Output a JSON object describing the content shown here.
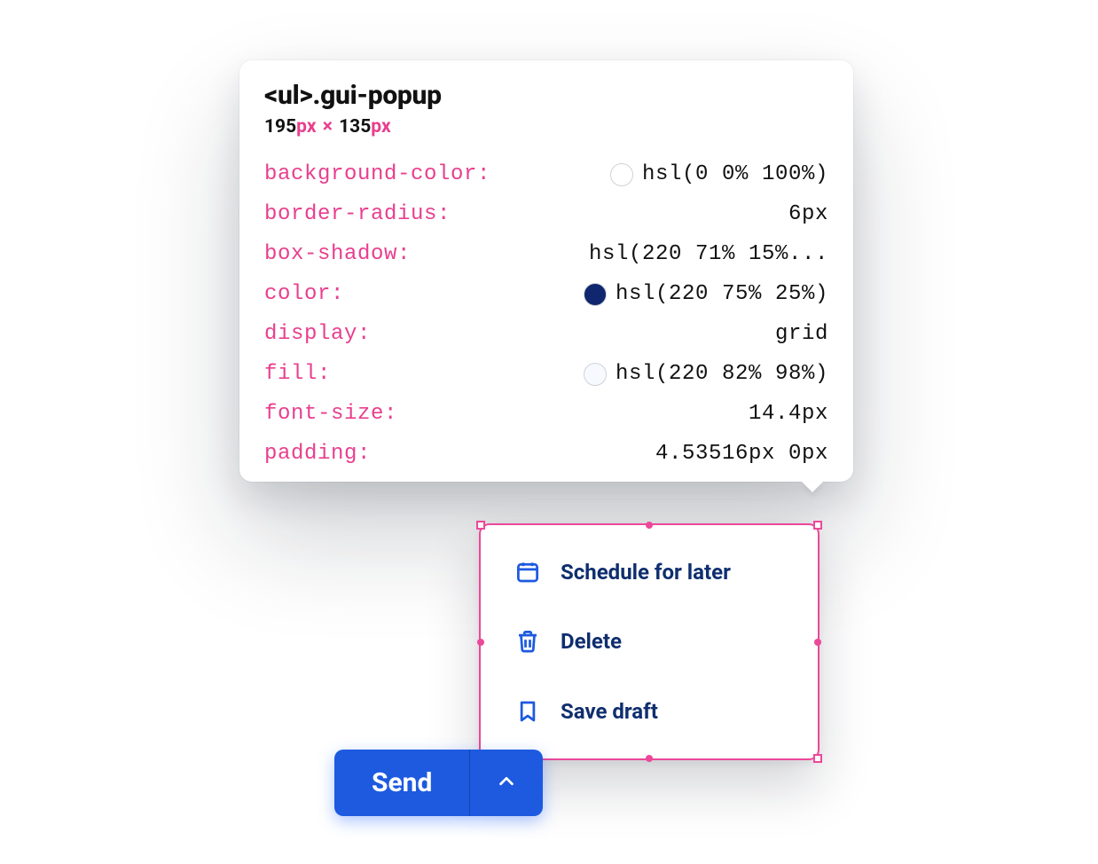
{
  "tooltip": {
    "selector": "<ul>.gui-popup",
    "width": "195",
    "height": "135",
    "unit": "px",
    "props": [
      {
        "name": "background-color",
        "value": "hsl(0 0% 100%)",
        "swatch": "#ffffff"
      },
      {
        "name": "border-radius",
        "value": "6px"
      },
      {
        "name": "box-shadow",
        "value": "hsl(220 71% 15%..."
      },
      {
        "name": "color",
        "value": "hsl(220 75% 25%)",
        "swatch": "#10276f"
      },
      {
        "name": "display",
        "value": "grid"
      },
      {
        "name": "fill",
        "value": "hsl(220 82% 98%)",
        "swatch": "#f6f9fe"
      },
      {
        "name": "font-size",
        "value": "14.4px"
      },
      {
        "name": "padding",
        "value": "4.53516px 0px"
      }
    ]
  },
  "popup": {
    "items": [
      {
        "icon": "calendar",
        "label": "Schedule for later"
      },
      {
        "icon": "trash",
        "label": "Delete"
      },
      {
        "icon": "bookmark",
        "label": "Save draft"
      }
    ]
  },
  "send": {
    "label": "Send"
  }
}
